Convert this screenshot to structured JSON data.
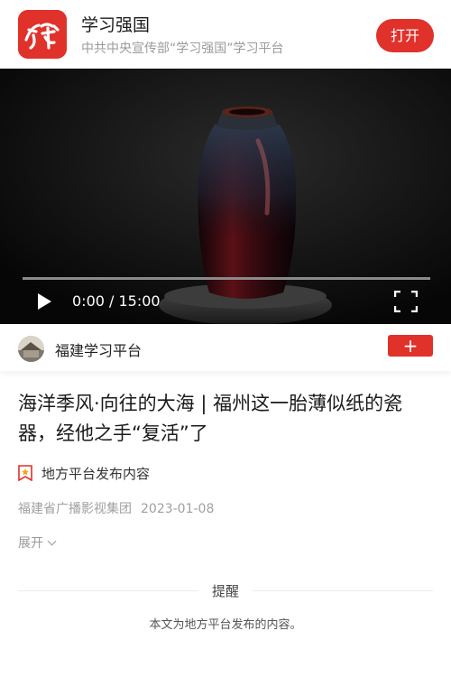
{
  "app_bar": {
    "app_name": "学习强国",
    "subtitle": "中共中央宣传部“学习强国”学习平台",
    "open_button": "打开",
    "brand_color": "#e0312b",
    "logo_icon": "xuexi-logo-icon"
  },
  "video": {
    "time": "0:00 / 15:00",
    "progress": 0,
    "play_icon": "play-icon",
    "fullscreen_icon": "fullscreen-icon"
  },
  "publisher": {
    "name": "福建学习平台",
    "follow_button": "+"
  },
  "article": {
    "title": "海洋季风·向往的大海 | 福州这一胎薄似纸的瓷器，经他之手“复活”了",
    "source_tag": "地方平台发布内容",
    "source_icon": "ribbon-star-icon",
    "author": "福建省广播影视集团",
    "date": "2023-01-08",
    "expand_label": "展开"
  },
  "notice": {
    "title": "提醒",
    "text": "本文为地方平台发布的内容。"
  }
}
